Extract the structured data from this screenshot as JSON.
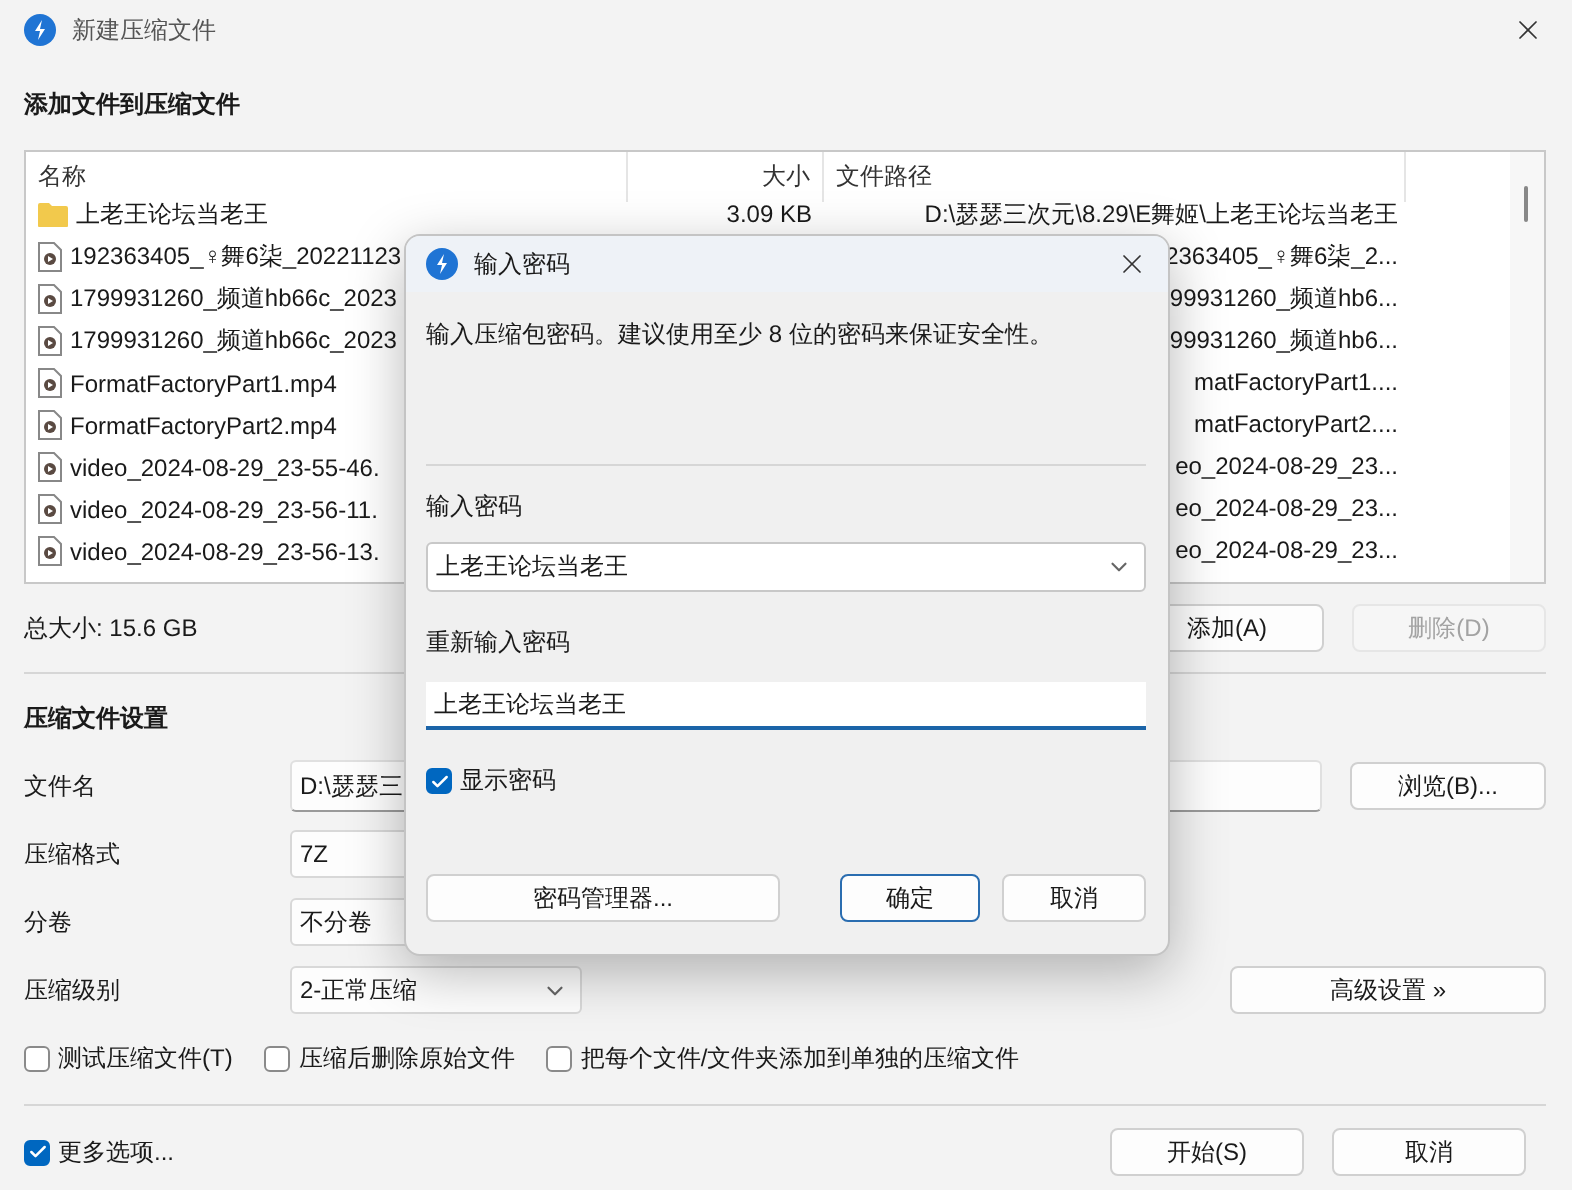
{
  "window": {
    "title": "新建压缩文件"
  },
  "files": {
    "title": "添加文件到压缩文件",
    "columns": [
      "名称",
      "大小",
      "文件路径"
    ],
    "rows": [
      {
        "kind": "folder",
        "name": "上老王论坛当老王",
        "size": "3.09 KB",
        "path": "D:\\瑟瑟三次元\\8.29\\E舞姬\\上老王论坛当老王"
      },
      {
        "kind": "video",
        "name": "192363405_♀舞6柒_20221123",
        "path": "2363405_♀舞6柒_2..."
      },
      {
        "kind": "video",
        "name": "1799931260_频道hb66c_2023",
        "path": "99931260_频道hb6..."
      },
      {
        "kind": "video",
        "name": "1799931260_频道hb66c_2023",
        "path": "99931260_频道hb6..."
      },
      {
        "kind": "video",
        "name": "FormatFactoryPart1.mp4",
        "path": "matFactoryPart1...."
      },
      {
        "kind": "video",
        "name": "FormatFactoryPart2.mp4",
        "path": "matFactoryPart2...."
      },
      {
        "kind": "video",
        "name": "video_2024-08-29_23-55-46.",
        "path": "eo_2024-08-29_23..."
      },
      {
        "kind": "video",
        "name": "video_2024-08-29_23-56-11.",
        "path": "eo_2024-08-29_23..."
      },
      {
        "kind": "video",
        "name": "video_2024-08-29_23-56-13.",
        "path": "eo_2024-08-29_23..."
      }
    ]
  },
  "total_size": "总大小: 15.6 GB",
  "file_buttons": [
    {
      "label": "添加(A)",
      "disabled": false
    },
    {
      "label": "删除(D)",
      "disabled": true
    }
  ],
  "settings": {
    "title": "压缩文件设置",
    "fields": [
      {
        "kind": "text",
        "label": "文件名",
        "value": "D:\\瑟瑟三"
      },
      {
        "kind": "select",
        "label": "压缩格式",
        "value": "7Z"
      },
      {
        "kind": "select",
        "label": "分卷",
        "value": "不分卷"
      },
      {
        "kind": "select",
        "label": "压缩级别",
        "value": "2-正常压缩"
      }
    ],
    "browse_button": "浏览(B)...",
    "advanced_button": "高级设置 »",
    "options": [
      {
        "label": "测试压缩文件(T)",
        "checked": false
      },
      {
        "label": "压缩后删除原始文件",
        "checked": false
      },
      {
        "label": "把每个文件/文件夹添加到单独的压缩文件",
        "checked": false
      }
    ]
  },
  "more_options": {
    "label": "更多选项...",
    "checked": true
  },
  "buttons": [
    "开始(S)",
    "取消"
  ],
  "dialog": {
    "title": "输入密码",
    "message": "输入压缩包密码。建议使用至少 8 位的密码来保证安全性。",
    "password_label": "输入密码",
    "password": "上老王论坛当老王",
    "confirm_label": "重新输入密码",
    "confirm": "上老王论坛当老王",
    "show_password": {
      "label": "显示密码",
      "checked": true
    },
    "buttons": [
      {
        "label": "密码管理器...",
        "kind": "normal"
      },
      {
        "label": "确定",
        "kind": "default"
      },
      {
        "label": "取消",
        "kind": "normal"
      }
    ]
  }
}
